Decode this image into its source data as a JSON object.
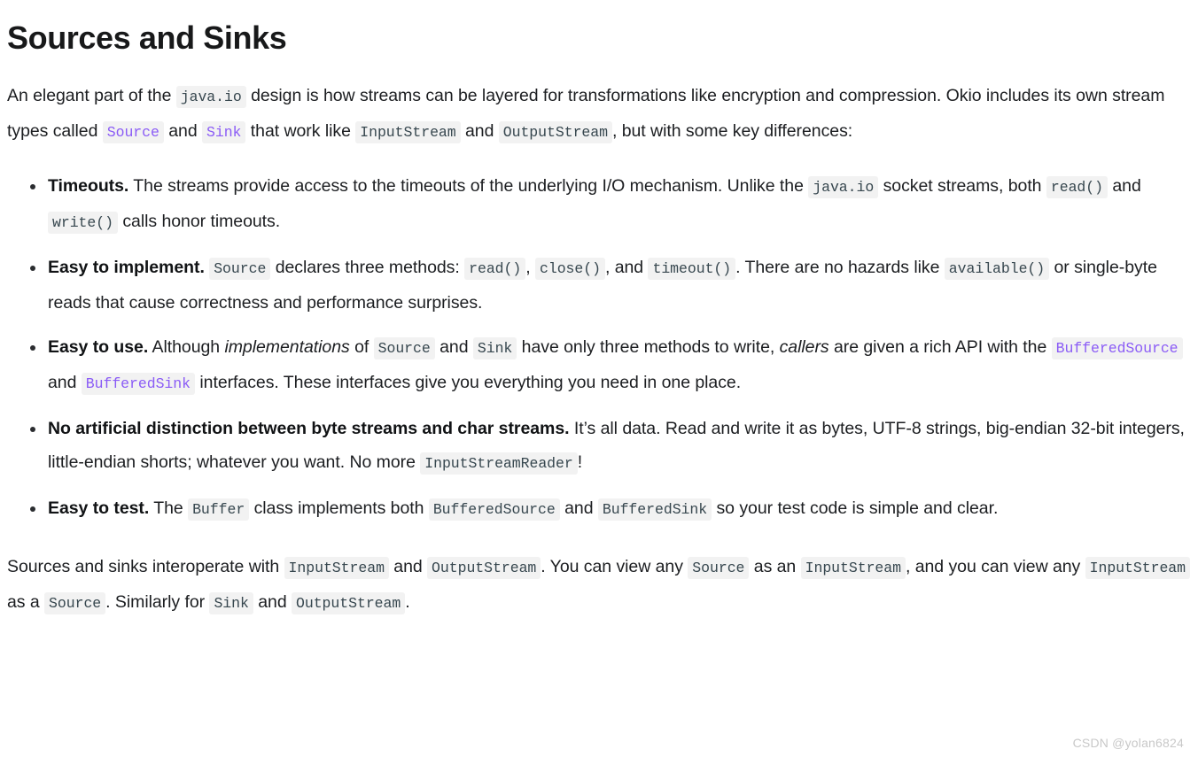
{
  "page": {
    "title": "Sources and Sinks",
    "watermark": "CSDN @yolan6824"
  },
  "colors": {
    "code_link": "#8b5cf6",
    "code_plain": "#37474f",
    "code_background": "#f2f2f2",
    "body_text": "#1c1e21"
  },
  "intro": {
    "t1": "An elegant part of the ",
    "code1": "java.io",
    "t2": " design is how streams can be layered for transformations like encryption and compression. Okio includes its own stream types called ",
    "code2": "Source",
    "t3": " and ",
    "code3": "Sink",
    "t4": " that work like ",
    "code4": "InputStream",
    "t5": " and ",
    "code5": "OutputStream",
    "t6": ", but with some key differences:"
  },
  "bullets": [
    {
      "lead": "Timeouts.",
      "t1": " The streams provide access to the timeouts of the underlying I/O mechanism. Unlike the ",
      "code1": "java.io",
      "t2": " socket streams, both ",
      "code2": "read()",
      "t3": " and ",
      "code3": "write()",
      "t4": " calls honor timeouts."
    },
    {
      "lead": "Easy to implement.",
      "t1": " ",
      "code1": "Source",
      "t2": " declares three methods: ",
      "code2": "read()",
      "t3": ", ",
      "code3": "close()",
      "t4": ", and ",
      "code4": "timeout()",
      "t5": ". There are no hazards like ",
      "code5": "available()",
      "t6": " or single-byte reads that cause correctness and performance surprises."
    },
    {
      "lead": "Easy to use.",
      "t1": " Although ",
      "em1": "implementations",
      "t2": " of ",
      "code1": "Source",
      "t3": " and ",
      "code2": "Sink",
      "t4": " have only three methods to write, ",
      "em2": "callers",
      "t5": " are given a rich API with the ",
      "code3": "BufferedSource",
      "t6": " and ",
      "code4": "BufferedSink",
      "t7": " interfaces. These interfaces give you everything you need in one place."
    },
    {
      "lead": "No artificial distinction between byte streams and char streams.",
      "t1": " It’s all data. Read and write it as bytes, UTF-8 strings, big-endian 32-bit integers, little-endian shorts; whatever you want. No more ",
      "code1": "InputStreamReader",
      "t2": "!"
    },
    {
      "lead": "Easy to test.",
      "t1": " The ",
      "code1": "Buffer",
      "t2": " class implements both ",
      "code2": "BufferedSource",
      "t3": " and ",
      "code3": "BufferedSink",
      "t4": " so your test code is simple and clear."
    }
  ],
  "outro": {
    "t1": "Sources and sinks interoperate with ",
    "code1": "InputStream",
    "t2": " and ",
    "code2": "OutputStream",
    "t3": ". You can view any ",
    "code3": "Source",
    "t4": " as an ",
    "code4": "InputStream",
    "t5": ", and you can view any ",
    "code5": "InputStream",
    "t6": " as a ",
    "code6": "Source",
    "t7": ". Similarly for ",
    "code7": "Sink",
    "t8": " and ",
    "code8": "OutputStream",
    "t9": "."
  }
}
